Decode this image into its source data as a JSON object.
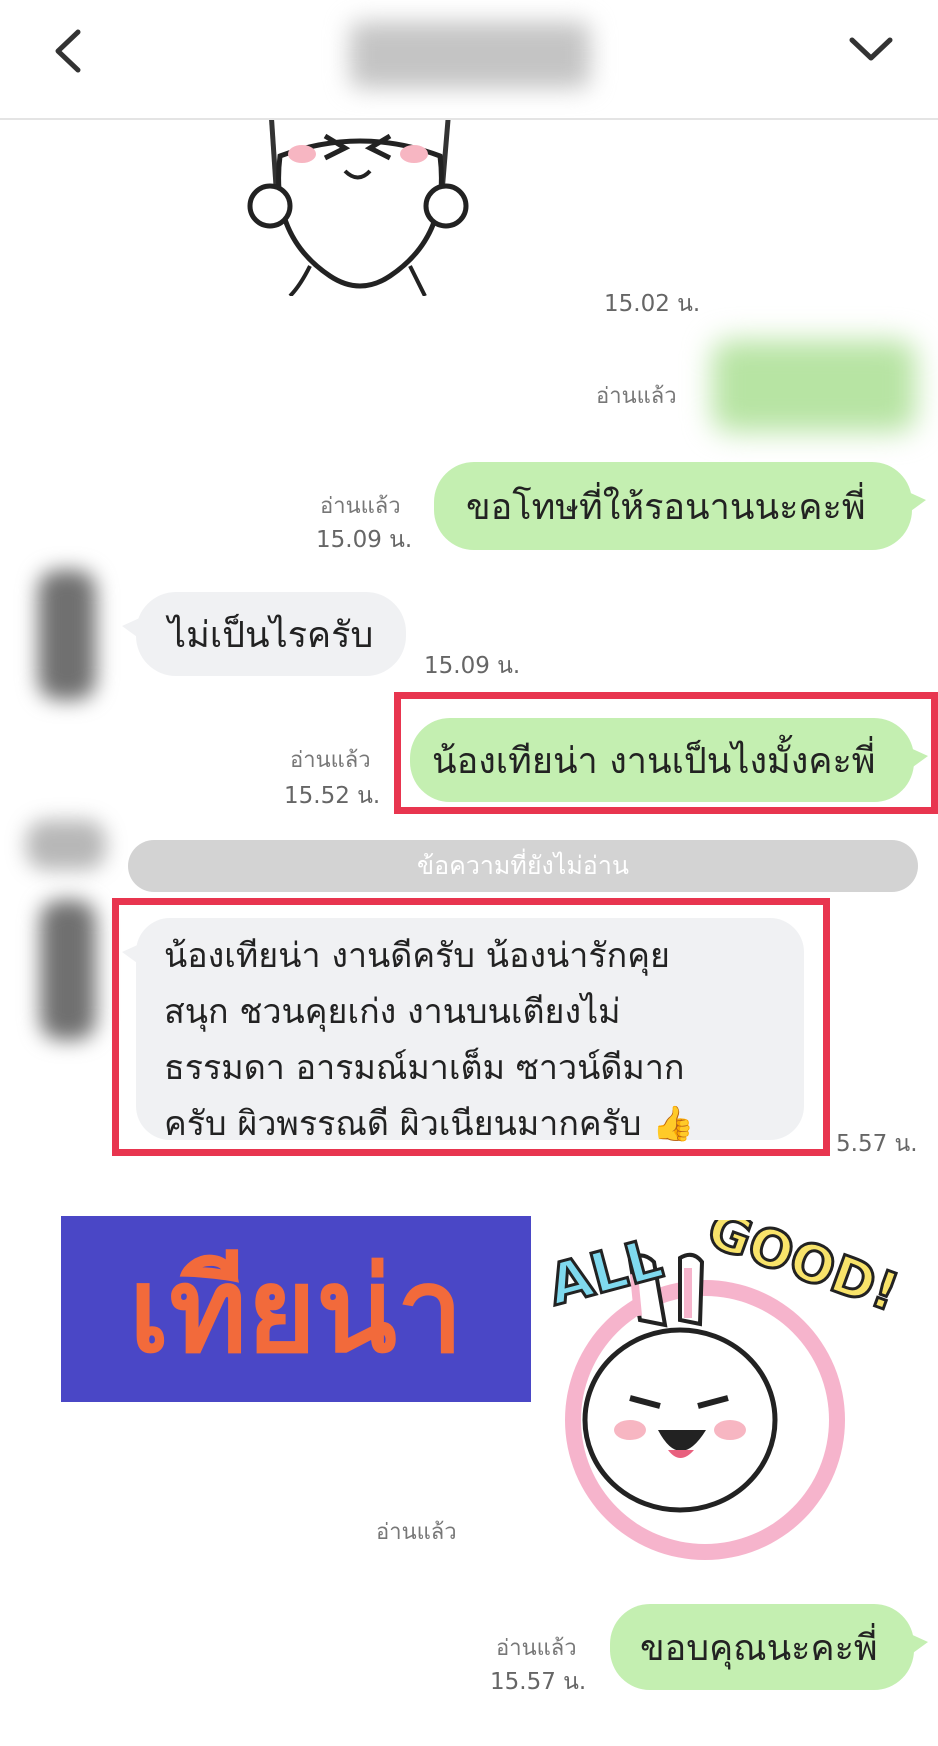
{
  "header": {
    "back_icon": "chevron-left-icon",
    "menu_icon": "chevron-down-icon"
  },
  "messages": {
    "sticker1_time": "15.02 น.",
    "blurred_read": "อ่านแล้ว",
    "msg1": {
      "read": "อ่านแล้ว",
      "time": "15.09 น.",
      "text": "ขอโทษที่ให้รอนานนะคะพี่"
    },
    "msg2": {
      "text": "ไม่เป็นไรครับ",
      "time": "15.09 น."
    },
    "msg3": {
      "read": "อ่านแล้ว",
      "time": "15.52 น.",
      "text": "น้องเทียน่า งานเป็นไงมั้งคะพี่"
    },
    "unread_divider": "ข้อความที่ยังไม่อ่าน",
    "msg4": {
      "lines": [
        "น้องเทียน่า งานดีครับ น้องน่ารักคุย",
        "สนุก ชวนคุยเก่ง งานบนเตียงไม่",
        "ธรรมดา อารมณ์มาเต็ม ซาวน์ดีมาก",
        "ครับ ผิวพรรณดี ผิวเนียนมากครับ 👍"
      ],
      "time": "5.57 น."
    },
    "watermark": "เทียน่า",
    "sticker2_text": "ALL GOOD!",
    "sticker2_read": "อ่านแล้ว",
    "msg5": {
      "read": "อ่านแล้ว",
      "time": "15.57 น.",
      "text": "ขอบคุณนะคะพี่"
    }
  },
  "colors": {
    "outgoing_bubble": "#c4efb1",
    "incoming_bubble": "#f0f1f3",
    "highlight": "#e8354f",
    "watermark_bg": "#4a47c6",
    "watermark_text": "#f26a3b"
  }
}
